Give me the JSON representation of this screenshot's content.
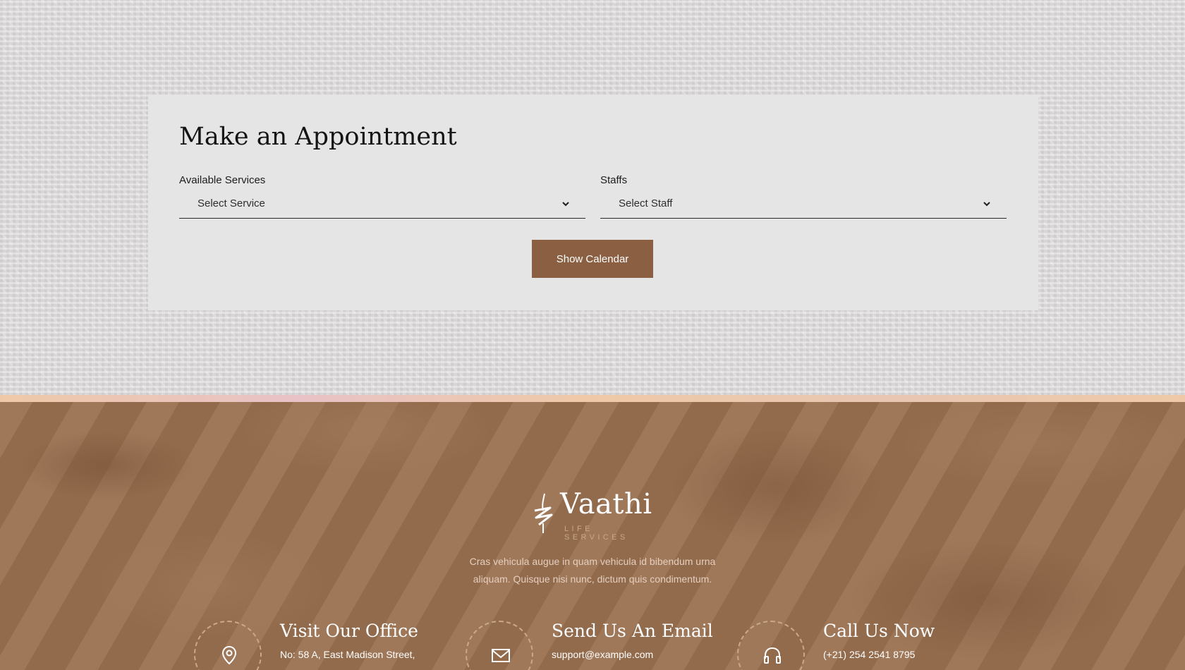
{
  "appointment": {
    "title": "Make an Appointment",
    "services_label": "Available Services",
    "services_value": "Select Service",
    "staffs_label": "Staffs",
    "staffs_value": "Select Staff",
    "button_label": "Show Calendar"
  },
  "footer": {
    "brand_name": "Vaathi",
    "brand_tagline": "LIFE SERVICES",
    "about_text": "Cras vehicula augue in quam vehicula id bibendum urna aliquam. Quisque nisi nunc, dictum quis condimentum.",
    "contacts": [
      {
        "title": "Visit Our Office",
        "text": "No: 58 A, East Madison Street,",
        "icon": "location-pin-icon"
      },
      {
        "title": "Send Us An Email",
        "text": "support@example.com",
        "icon": "envelope-icon"
      },
      {
        "title": "Call Us Now",
        "text": "(+21) 254 2541 8795",
        "icon": "headphones-icon"
      }
    ]
  },
  "colors": {
    "button": "#8b5f42",
    "footer_bg": "#9a7050",
    "accent_stripe": "#efc9a7"
  }
}
